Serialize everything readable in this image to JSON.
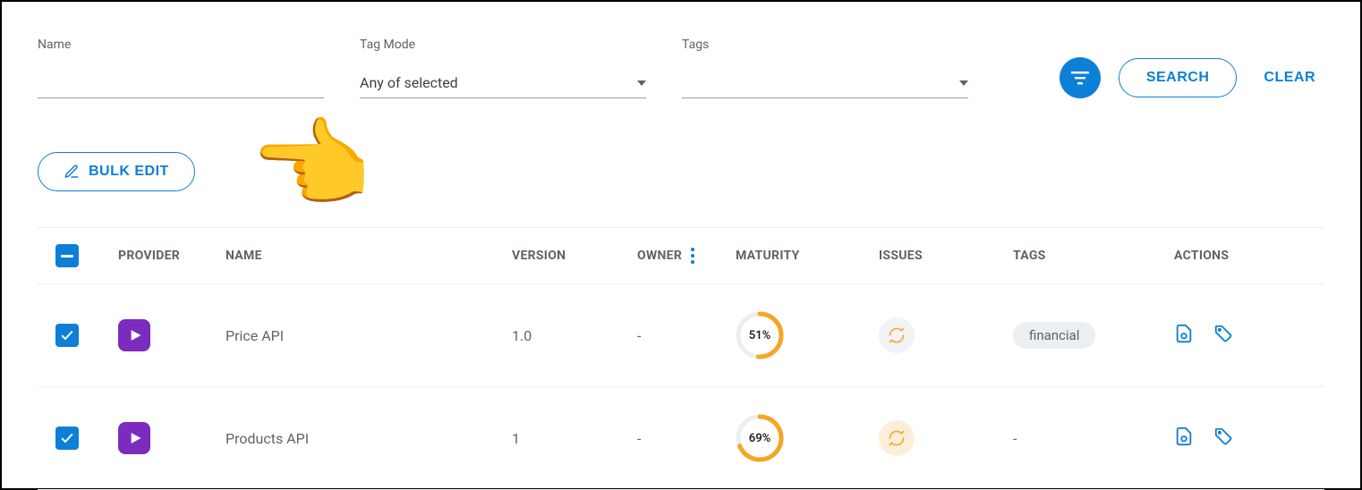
{
  "filters": {
    "name_label": "Name",
    "name_value": "",
    "tag_mode_label": "Tag Mode",
    "tag_mode_value": "Any of selected",
    "tags_label": "Tags",
    "tags_value": ""
  },
  "actions": {
    "search_label": "SEARCH",
    "clear_label": "CLEAR",
    "bulk_edit_label": "BULK EDIT"
  },
  "columns": {
    "provider": "PROVIDER",
    "name": "NAME",
    "version": "VERSION",
    "owner": "OWNER",
    "maturity": "MATURITY",
    "issues": "ISSUES",
    "tags": "TAGS",
    "actions": "ACTIONS"
  },
  "rows": [
    {
      "checked": true,
      "name": "Price API",
      "version": "1.0",
      "owner": "-",
      "maturity_pct": 51,
      "maturity_label": "51%",
      "issues_active": false,
      "tags": [
        "financial"
      ]
    },
    {
      "checked": true,
      "name": "Products API",
      "version": "1",
      "owner": "-",
      "maturity_pct": 69,
      "maturity_label": "69%",
      "issues_active": true,
      "tags": []
    }
  ],
  "colors": {
    "primary": "#0d7fd6",
    "maturity": "#f5a623",
    "provider": "#7b2cbf"
  }
}
